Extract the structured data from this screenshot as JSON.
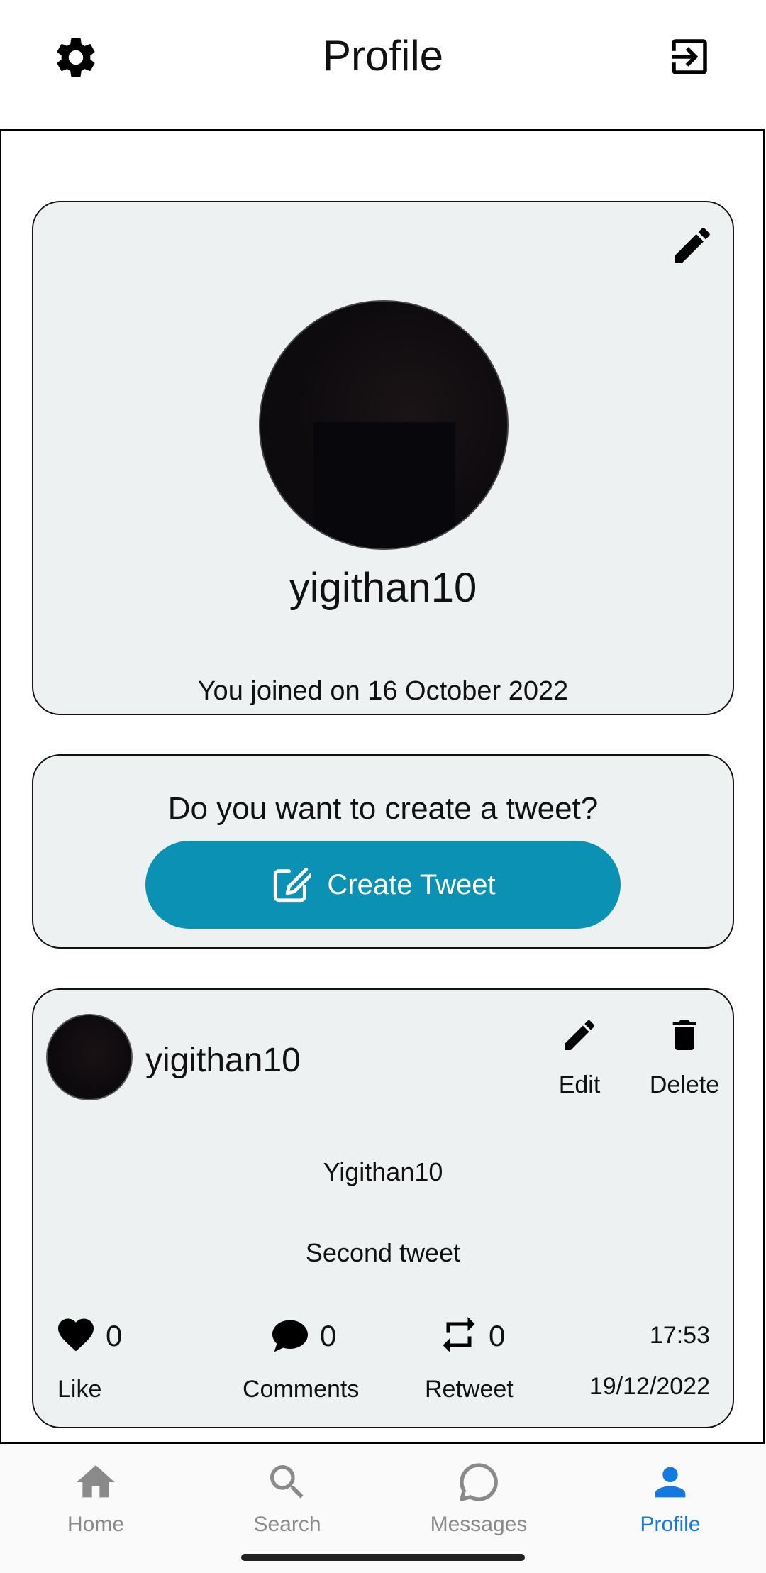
{
  "header": {
    "title": "Profile",
    "settings_icon": "gear-icon",
    "logout_icon": "logout-icon"
  },
  "profile": {
    "username": "yigithan10",
    "joined_text": "You joined on  16 October 2022",
    "edit_icon": "pencil-icon"
  },
  "create": {
    "question": "Do you want to create a tweet?",
    "button_label": "Create Tweet",
    "button_color": "#0a91b3"
  },
  "tweet": {
    "username": "yigithan10",
    "edit_label": "Edit",
    "delete_label": "Delete",
    "title": "Yigithan10",
    "body": "Second tweet",
    "likes": "0",
    "like_label": "Like",
    "comments": "0",
    "comments_label": "Comments",
    "retweets": "0",
    "retweet_label": "Retweet",
    "time": "17:53",
    "date": "19/12/2022"
  },
  "nav": {
    "items": [
      {
        "label": "Home",
        "icon": "home-icon"
      },
      {
        "label": "Search",
        "icon": "search-icon"
      },
      {
        "label": "Messages",
        "icon": "chat-bubble-icon"
      },
      {
        "label": "Profile",
        "icon": "person-icon"
      }
    ],
    "active": "Profile",
    "active_color": "#1479e0",
    "inactive_color": "#8a8a8a"
  }
}
